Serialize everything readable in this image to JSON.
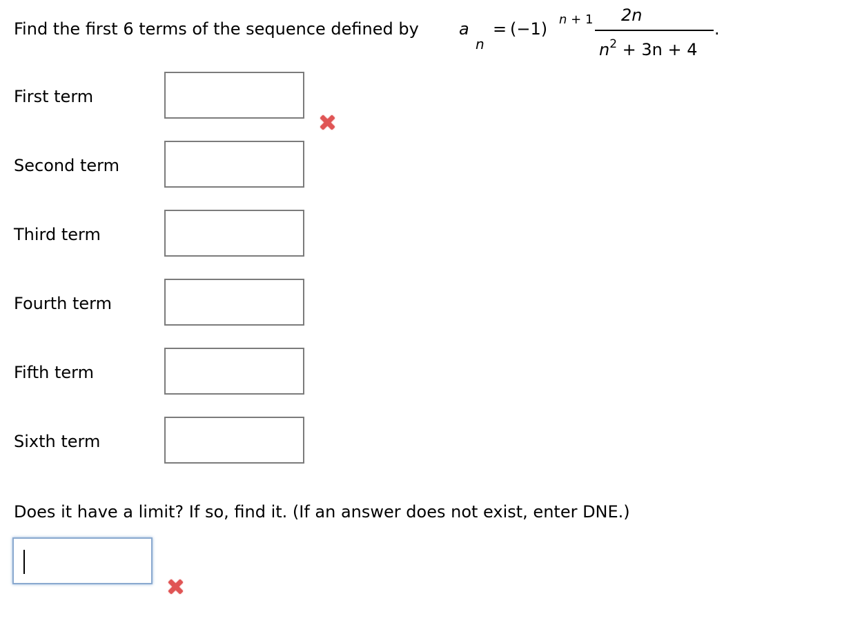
{
  "question": {
    "prompt": "Find the first 6 terms of the sequence defined by",
    "formula": {
      "lhs_var": "a",
      "lhs_sub": "n",
      "equals": "=",
      "base": "(−1)",
      "exponent_var": "n",
      "exponent_rest": " + 1",
      "numerator": "2n",
      "denominator_var": "n",
      "denominator_power": "2",
      "denominator_rest": " + 3n + 4",
      "period": "."
    }
  },
  "terms": [
    {
      "label": "First term",
      "value": "",
      "status": "incorrect"
    },
    {
      "label": "Second term",
      "value": "",
      "status": ""
    },
    {
      "label": "Third term",
      "value": "",
      "status": ""
    },
    {
      "label": "Fourth term",
      "value": "",
      "status": ""
    },
    {
      "label": "Fifth term",
      "value": "",
      "status": ""
    },
    {
      "label": "Sixth term",
      "value": "",
      "status": ""
    }
  ],
  "limit": {
    "prompt": "Does it have a limit? If so, find it. (If an answer does not exist, enter DNE.)",
    "value": "",
    "status": "incorrect"
  },
  "icons": {
    "incorrect": "red-x-mark"
  },
  "colors": {
    "incorrect": "#e05555",
    "input_border": "#7b7b7b",
    "focused_border": "#8aa9cf"
  }
}
